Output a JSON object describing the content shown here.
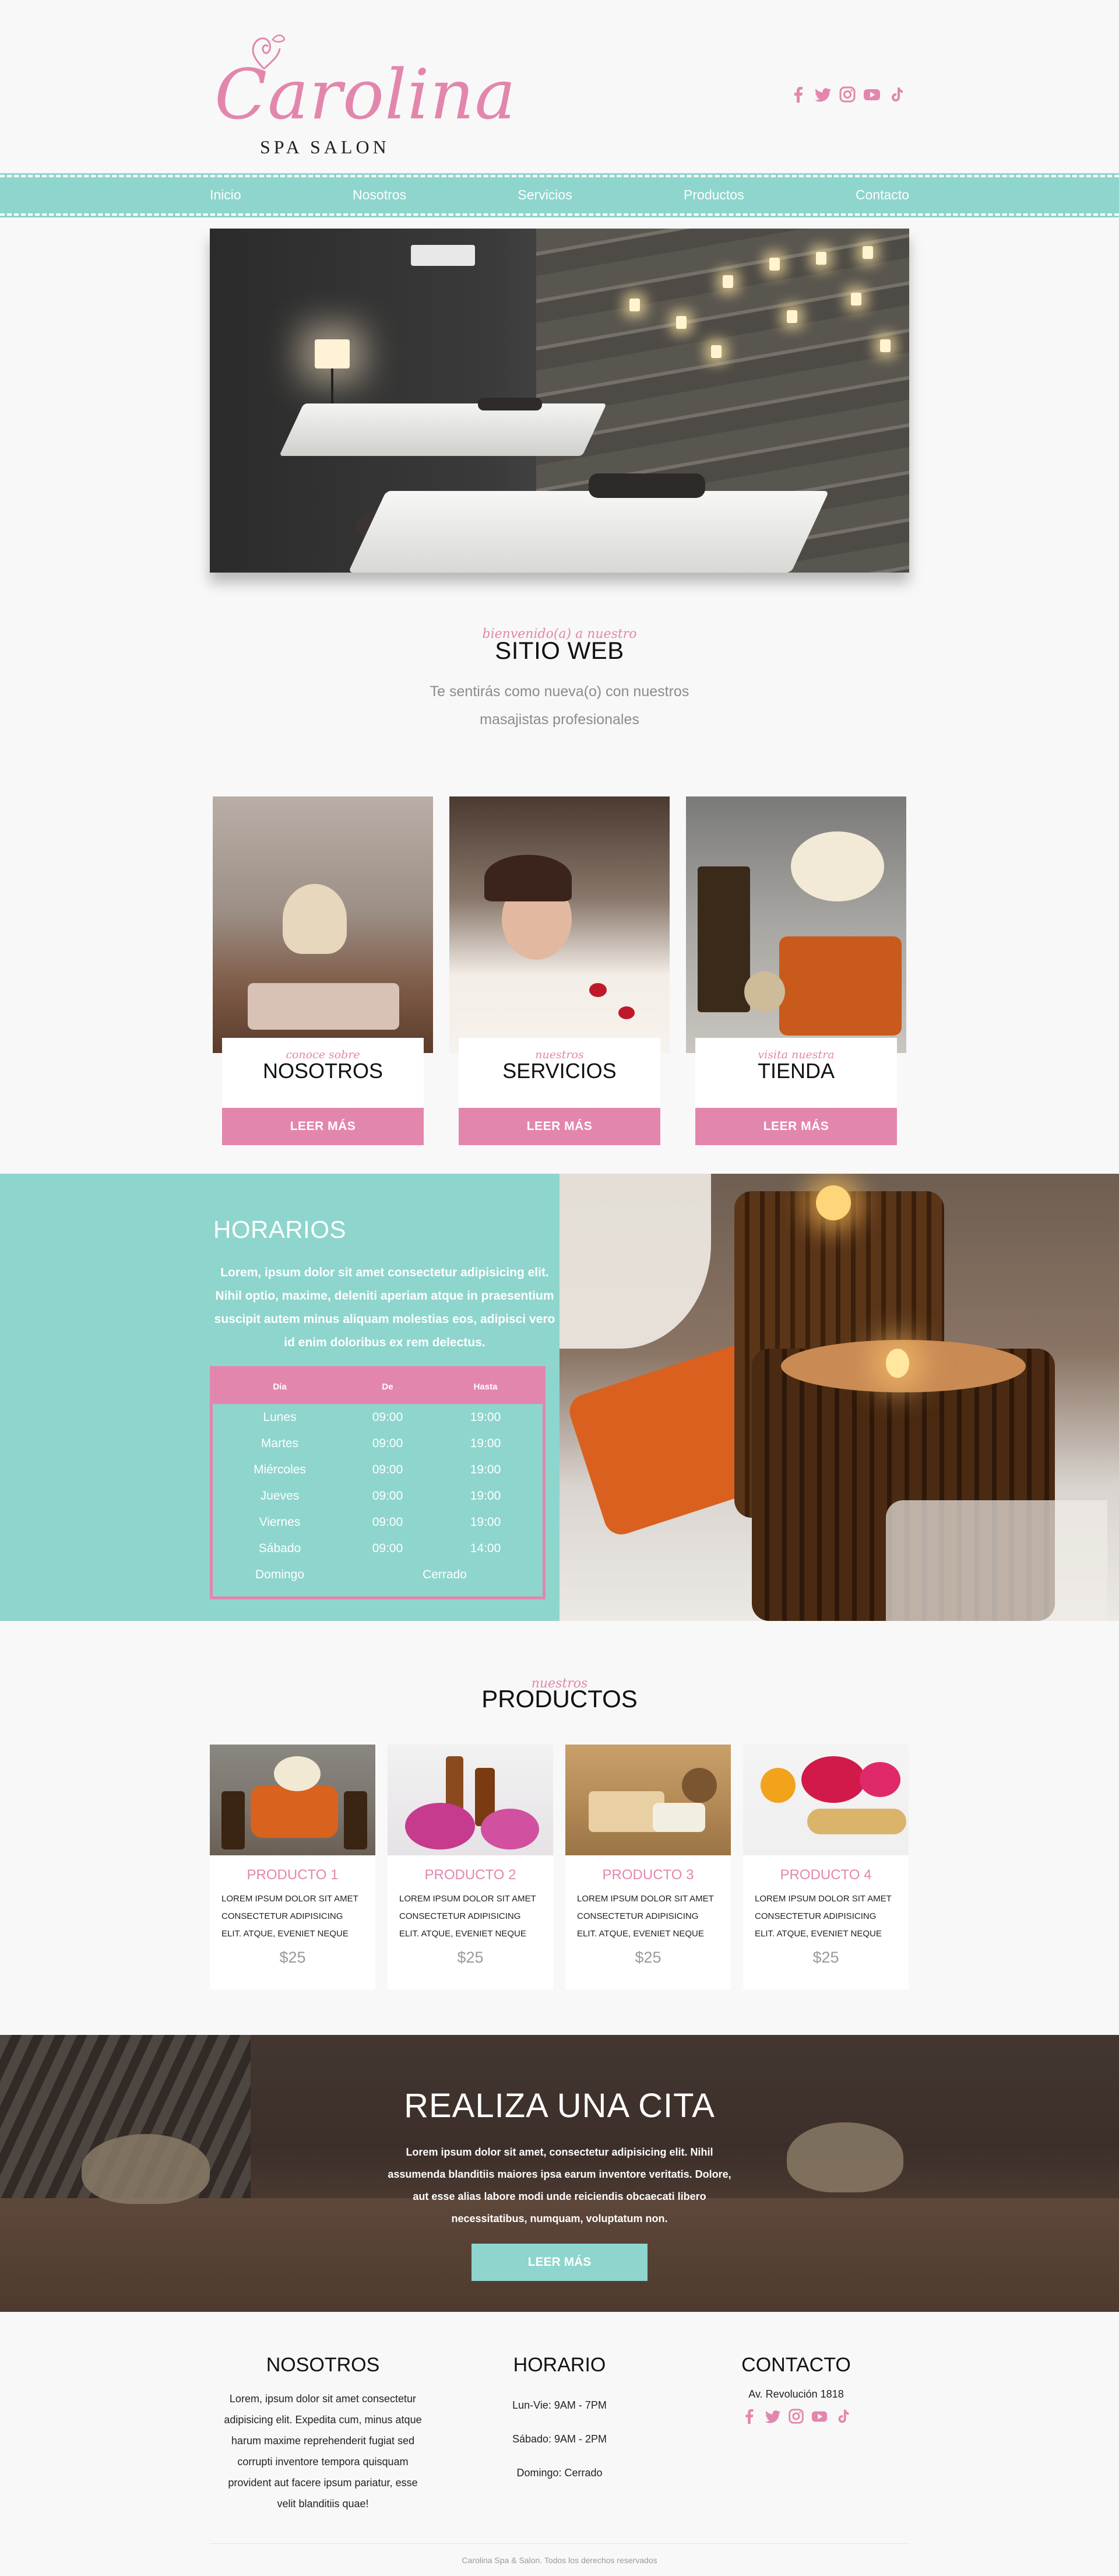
{
  "brand": {
    "name": "Carolina",
    "subtitle": "SPA SALON",
    "pink": "#e386ae",
    "teal": "#8ed5cd"
  },
  "socials": [
    "facebook-icon",
    "twitter-icon",
    "instagram-icon",
    "youtube-icon",
    "tiktok-icon"
  ],
  "nav": {
    "items": [
      {
        "label": "Inicio"
      },
      {
        "label": "Nosotros"
      },
      {
        "label": "Servicios"
      },
      {
        "label": "Productos"
      },
      {
        "label": "Contacto"
      }
    ]
  },
  "welcome": {
    "kicker": "bienvenido(a) a nuestro",
    "title": "SITIO WEB",
    "text": "Te sentirás como nueva(o) con nuestros masajistas profesionales"
  },
  "cards": [
    {
      "kicker": "conoce sobre",
      "title": "NOSOTROS",
      "button": "LEER MÁS"
    },
    {
      "kicker": "nuestros",
      "title": "SERVICIOS",
      "button": "LEER MÁS"
    },
    {
      "kicker": "visita nuestra",
      "title": "TIENDA",
      "button": "LEER MÁS"
    }
  ],
  "hours": {
    "title": "HORARIOS",
    "text": "Lorem, ipsum dolor sit amet consectetur adipisicing elit. Nihil optio, maxime, deleniti aperiam atque in praesentium suscipit autem minus aliquam molestias eos, adipisci vero id enim doloribus ex rem delectus.",
    "headers": {
      "day": "Día",
      "from": "De",
      "to": "Hasta"
    },
    "rows": [
      {
        "day": "Lunes",
        "from": "09:00",
        "to": "19:00"
      },
      {
        "day": "Martes",
        "from": "09:00",
        "to": "19:00"
      },
      {
        "day": "Miércoles",
        "from": "09:00",
        "to": "19:00"
      },
      {
        "day": "Jueves",
        "from": "09:00",
        "to": "19:00"
      },
      {
        "day": "Viernes",
        "from": "09:00",
        "to": "19:00"
      },
      {
        "day": "Sábado",
        "from": "09:00",
        "to": "14:00"
      }
    ],
    "closed": {
      "day": "Domingo",
      "label": "Cerrado"
    }
  },
  "products": {
    "kicker": "nuestros",
    "title": "PRODUCTOS",
    "items": [
      {
        "name": "PRODUCTO 1",
        "desc": "LOREM IPSUM DOLOR SIT AMET CONSECTETUR ADIPISICING ELIT. ATQUE, EVENIET NEQUE",
        "price": "$25"
      },
      {
        "name": "PRODUCTO 2",
        "desc": "LOREM IPSUM DOLOR SIT AMET CONSECTETUR ADIPISICING ELIT. ATQUE, EVENIET NEQUE",
        "price": "$25"
      },
      {
        "name": "PRODUCTO 3",
        "desc": "LOREM IPSUM DOLOR SIT AMET CONSECTETUR ADIPISICING ELIT. ATQUE, EVENIET NEQUE",
        "price": "$25"
      },
      {
        "name": "PRODUCTO 4",
        "desc": "LOREM IPSUM DOLOR SIT AMET CONSECTETUR ADIPISICING ELIT. ATQUE, EVENIET NEQUE",
        "price": "$25"
      }
    ]
  },
  "appointment": {
    "title": "REALIZA UNA CITA",
    "text": "Lorem ipsum dolor sit amet, consectetur adipisicing elit. Nihil assumenda blanditiis maiores ipsa earum inventore veritatis. Dolore, aut esse alias labore modi unde reiciendis obcaecati libero necessitatibus, numquam, voluptatum non.",
    "button": "LEER MÁS"
  },
  "footer": {
    "about": {
      "title": "NOSOTROS",
      "text": "Lorem, ipsum dolor sit amet consectetur adipisicing elit. Expedita cum, minus atque harum maxime reprehenderit fugiat sed corrupti inventore tempora quisquam provident aut facere ipsum pariatur, esse velit blanditiis quae!"
    },
    "schedule": {
      "title": "HORARIO",
      "lines": [
        "Lun-Vie: 9AM - 7PM",
        "Sábado: 9AM - 2PM",
        "Domingo: Cerrado"
      ]
    },
    "contact": {
      "title": "CONTACTO",
      "address": "Av. Revolución 1818"
    },
    "copyright": "Carolina Spa & Salon. Todos los derechos reservados"
  }
}
